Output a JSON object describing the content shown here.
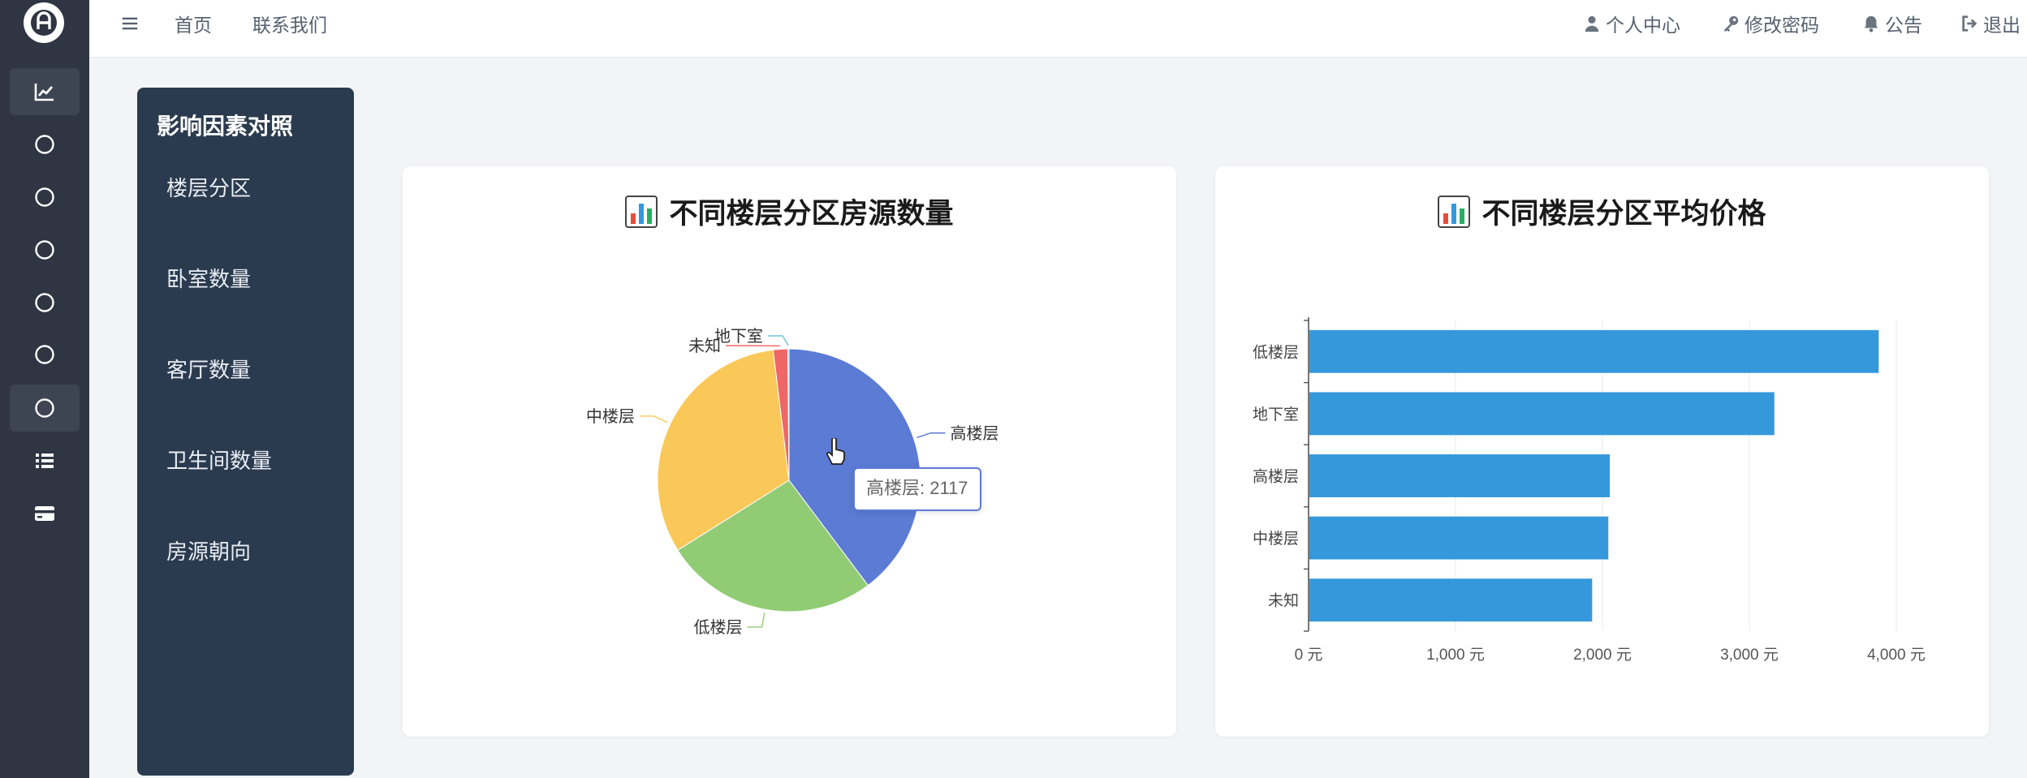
{
  "rail": {
    "items": [
      {
        "icon": "line-chart-icon",
        "active": true
      },
      {
        "icon": "circle-icon",
        "active": false
      },
      {
        "icon": "circle-icon",
        "active": false
      },
      {
        "icon": "circle-icon",
        "active": false
      },
      {
        "icon": "circle-icon",
        "active": false
      },
      {
        "icon": "circle-icon",
        "active": false
      },
      {
        "icon": "circle-icon",
        "active": true
      },
      {
        "icon": "list-icon",
        "active": false
      },
      {
        "icon": "card-icon",
        "active": false
      }
    ]
  },
  "topbar": {
    "nav": [
      "首页",
      "联系我们"
    ],
    "right": [
      {
        "icon": "user-icon",
        "label": "个人中心"
      },
      {
        "icon": "key-icon",
        "label": "修改密码"
      },
      {
        "icon": "bell-icon",
        "label": "公告"
      },
      {
        "icon": "sign-out-icon",
        "label": "退出"
      }
    ]
  },
  "subpanel": {
    "title": "影响因素对照",
    "items": [
      "楼层分区",
      "卧室数量",
      "客厅数量",
      "卫生间数量",
      "房源朝向"
    ]
  },
  "pie_card": {
    "title": "不同楼层分区房源数量",
    "tooltip": "高楼层: 2117"
  },
  "bar_card": {
    "title": "不同楼层分区平均价格"
  },
  "colors": {
    "rail_bg": "#2f3542",
    "panel_bg": "#2b3b4f",
    "pie": [
      "#5b7bd5",
      "#91cc75",
      "#fac858",
      "#ee6666",
      "#73c0de"
    ],
    "bar": "#3498db"
  },
  "chart_data": [
    {
      "type": "pie",
      "title": "不同楼层分区房源数量",
      "categories": [
        "高楼层",
        "低楼层",
        "中楼层",
        "未知",
        "地下室"
      ],
      "values": [
        2117,
        1402,
        1704,
        95,
        8
      ],
      "legend": "none"
    },
    {
      "type": "bar",
      "orientation": "horizontal",
      "title": "不同楼层分区平均价格",
      "categories": [
        "低楼层",
        "地下室",
        "高楼层",
        "中楼层",
        "未知"
      ],
      "values": [
        3880,
        3170,
        2050,
        2040,
        1930
      ],
      "xlim": [
        0,
        4000
      ],
      "xticks": [
        "0 元",
        "1,000 元",
        "2,000 元",
        "3,000 元",
        "4,000 元"
      ],
      "grid": true
    }
  ]
}
